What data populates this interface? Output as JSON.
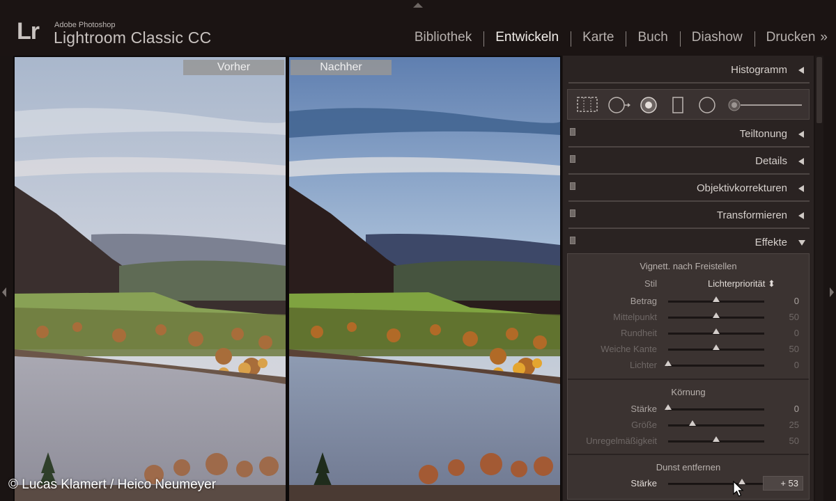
{
  "app": {
    "brand_small": "Adobe Photoshop",
    "brand_large": "Lightroom Classic CC",
    "logo": "Lr"
  },
  "modules": [
    {
      "label": "Bibliothek",
      "active": false
    },
    {
      "label": "Entwickeln",
      "active": true
    },
    {
      "label": "Karte",
      "active": false
    },
    {
      "label": "Buch",
      "active": false
    },
    {
      "label": "Diashow",
      "active": false
    },
    {
      "label": "Drucken",
      "active": false
    }
  ],
  "modules_more": "»",
  "compare": {
    "before_label": "Vorher",
    "after_label": "Nachher"
  },
  "panel": {
    "histogram": "Histogramm",
    "split_toning": "Teiltonung",
    "details": "Details",
    "lens_corrections": "Objektivkorrekturen",
    "transform": "Transformieren",
    "effects": "Effekte"
  },
  "effects": {
    "vignette": {
      "title": "Vignett. nach Freistellen",
      "style_label": "Stil",
      "style_value": "Lichterpriorität ⬍",
      "sliders": [
        {
          "label": "Betrag",
          "value": "0",
          "level": 0.5,
          "dim": false
        },
        {
          "label": "Mittelpunkt",
          "value": "50",
          "level": 0.5,
          "dim": true
        },
        {
          "label": "Rundheit",
          "value": "0",
          "level": 0.5,
          "dim": true
        },
        {
          "label": "Weiche Kante",
          "value": "50",
          "level": 0.5,
          "dim": true
        },
        {
          "label": "Lichter",
          "value": "0",
          "level": 0.0,
          "dim": true
        }
      ]
    },
    "grain": {
      "title": "Körnung",
      "sliders": [
        {
          "label": "Stärke",
          "value": "0",
          "level": 0.0,
          "dim": false
        },
        {
          "label": "Größe",
          "value": "25",
          "level": 0.25,
          "dim": true
        },
        {
          "label": "Unregelmäßigkeit",
          "value": "50",
          "level": 0.5,
          "dim": true
        }
      ]
    },
    "dehaze": {
      "title": "Dunst entfernen",
      "label": "Stärke",
      "value": "+ 53",
      "level": 0.765
    }
  },
  "credit": "© Lucas Klamert / Heico Neumeyer",
  "colors": {
    "background": "#1b1413",
    "panel": "#2a2322",
    "active_module": "#f2eeea"
  }
}
